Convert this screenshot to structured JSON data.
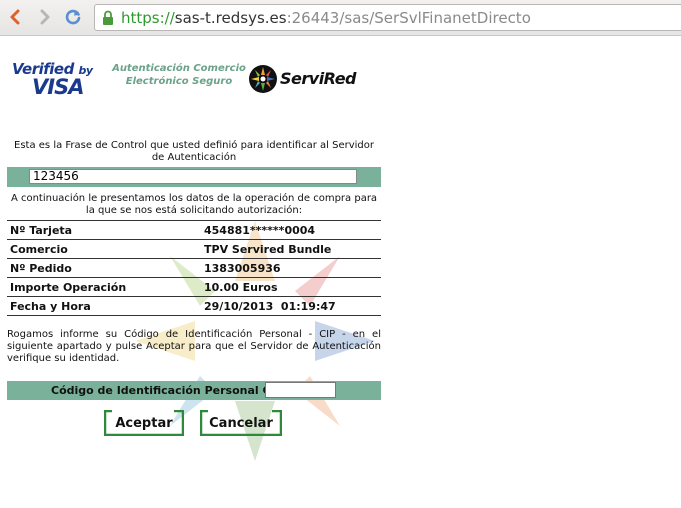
{
  "browser": {
    "url_scheme": "https://",
    "url_host": "sas-t.redsys.es",
    "url_rest": ":26443/sas/SerSvlFinanetDirecto"
  },
  "header": {
    "vbv_line1": "Verified",
    "vbv_by": "by",
    "vbv_line2": "VISA",
    "auth_line1": "Autenticación Comercio",
    "auth_line2": "Electrónico Seguro",
    "servired": "ServiRed"
  },
  "intro": {
    "control_phrase_text": "Esta es la Frase de Control que usted definió para identificar al Servidor de Autenticación",
    "control_phrase_value": "123456",
    "purchase_text": "A continuación le presentamos los datos de la operación de compra para la que se nos está solicitando autorización:"
  },
  "details": [
    {
      "label": "Nº Tarjeta",
      "value": "454881******0004"
    },
    {
      "label": "Comercio",
      "value": "TPV Servired Bundle"
    },
    {
      "label": "Nº Pedido",
      "value": "1383005936"
    },
    {
      "label": "Importe Operación",
      "value": "10.00 Euros"
    },
    {
      "label": "Fecha y Hora",
      "value": "29/10/2013  01:19:47"
    }
  ],
  "instructions": "Rogamos informe su Código de Identificación Personal - CIP - en el siguiente apartado y pulse Aceptar para que el Servidor de Autenticación verifique su identidad.",
  "cip": {
    "label": "Código de Identificación Personal CIP",
    "value": ""
  },
  "buttons": {
    "accept": "Aceptar",
    "cancel": "Cancelar"
  },
  "colors": {
    "band": "#7ab19b",
    "visa_blue": "#1a3a8e",
    "url_green": "#2e9a2e"
  }
}
